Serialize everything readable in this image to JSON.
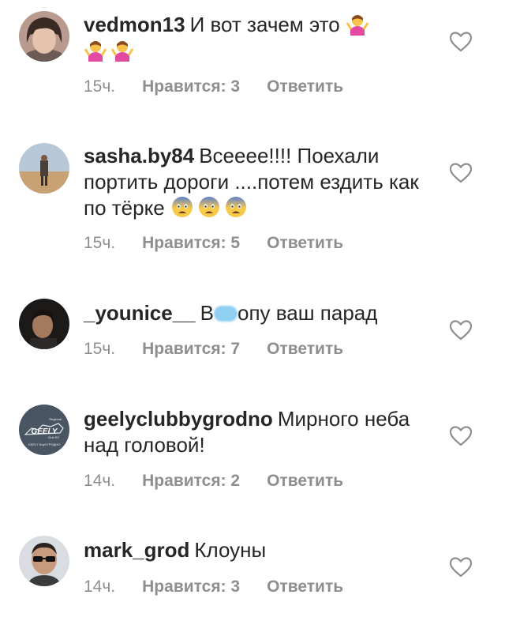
{
  "comments": [
    {
      "username": "vedmon13",
      "text": "И вот зачем это",
      "text_after": "",
      "emoji": [
        "person-shrugging-emoji",
        "person-shrugging-emoji",
        "person-shrugging-emoji"
      ],
      "time": "15ч.",
      "likes": "Нравится: 3",
      "reply": "Ответить"
    },
    {
      "username": "sasha.by84",
      "text": "Всееее!!!! Поехали портить дороги ....потем ездить как по тёрке",
      "text_after": "",
      "emoji": [
        "fearful-face-emoji",
        "fearful-face-emoji",
        "fearful-face-emoji"
      ],
      "time": "15ч.",
      "likes": "Нравится: 5",
      "reply": "Ответить"
    },
    {
      "username": "_younice__",
      "text": "В",
      "text_after": "опу ваш парад",
      "emoji": [],
      "time": "15ч.",
      "likes": "Нравится: 7",
      "reply": "Ответить"
    },
    {
      "username": "geelyclubbygrodno",
      "text": "Мирного неба над головой!",
      "text_after": "",
      "emoji": [],
      "time": "14ч.",
      "likes": "Нравится: 2",
      "reply": "Ответить"
    },
    {
      "username": "mark_grod",
      "text": "Клоуны",
      "text_after": "",
      "emoji": [],
      "time": "14ч.",
      "likes": "Нравится: 3",
      "reply": "Ответить"
    }
  ],
  "avatar_logo": {
    "line1": "Regional",
    "line2": "GEELY",
    "line3": "Club BY",
    "line4": "GEELY Клуб ГРОДНО"
  },
  "colors": {
    "text": "#262626",
    "meta": "#8e8e8e",
    "censor": "#8fd0f3"
  }
}
